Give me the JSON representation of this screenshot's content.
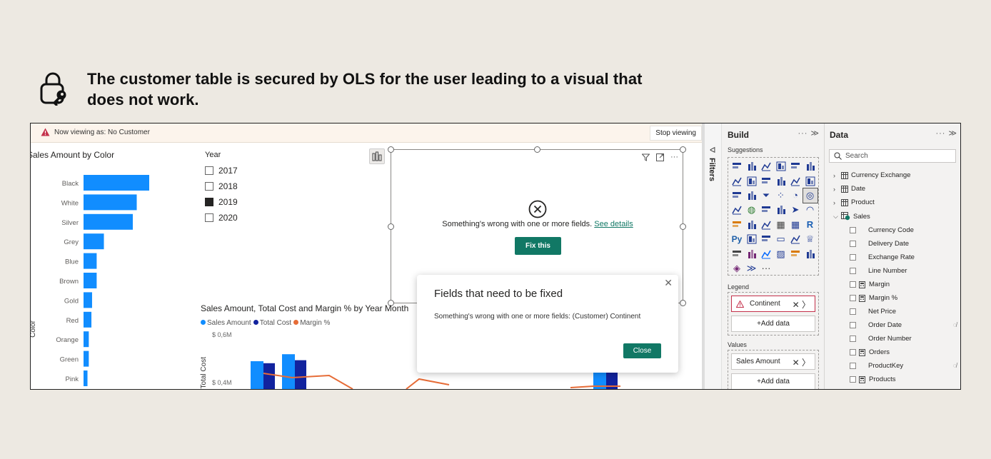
{
  "caption": {
    "text": "The customer table is secured by OLS for the user leading to a visual that does not work.",
    "icon": "lock-key-icon"
  },
  "banner": {
    "text": "Now viewing as: No Customer",
    "stop_label": "Stop viewing"
  },
  "bar_chart": {
    "title": "Sales Amount by Color",
    "axis_label": "Color"
  },
  "chart_data": [
    {
      "type": "bar",
      "orientation": "horizontal",
      "title": "Sales Amount by Color",
      "ylabel": "Color",
      "categories": [
        "Black",
        "White",
        "Silver",
        "Grey",
        "Blue",
        "Brown",
        "Gold",
        "Red",
        "Orange",
        "Green",
        "Pink"
      ],
      "values": [
        100,
        81,
        75,
        31,
        20,
        20,
        13,
        12,
        8,
        8,
        6
      ],
      "color": "#118dff",
      "grid": false
    },
    {
      "type": "bar",
      "title": "Sales Amount, Total Cost and Margin % by Year Month",
      "ylabel": "Total Cost",
      "series": [
        {
          "name": "Sales Amount",
          "color": "#118dff",
          "values": [
            0.35,
            0.42,
            0.38
          ]
        },
        {
          "name": "Total Cost",
          "color": "#12239e",
          "values": [
            0.33,
            0.36,
            0.36
          ]
        },
        {
          "name": "Margin %",
          "color": "#e66c37",
          "type": "line"
        }
      ],
      "yticks": [
        "$ 0,6M",
        "$ 0,4M"
      ]
    }
  ],
  "slicer": {
    "title": "Year",
    "items": [
      {
        "label": "2017",
        "checked": false
      },
      {
        "label": "2018",
        "checked": false
      },
      {
        "label": "2019",
        "checked": true
      },
      {
        "label": "2020",
        "checked": false
      }
    ]
  },
  "error_visual": {
    "message": "Something's wrong with one or more fields.",
    "link": "See details",
    "fix_label": "Fix this"
  },
  "combo_chart": {
    "title": "Sales Amount, Total Cost and Margin % by Year Month",
    "legend": [
      "Sales Amount",
      "Total Cost",
      "Margin %"
    ],
    "ytick_top": "$ 0,6M",
    "ytick_mid": "$ 0,4M",
    "ylabel": "Total Cost"
  },
  "dialog": {
    "title": "Fields that need to be fixed",
    "message": "Something's wrong with one or more fields: (Customer) Continent",
    "close_label": "Close"
  },
  "filters": {
    "label": "Filters"
  },
  "build": {
    "title": "Build",
    "suggestions_label": "Suggestions",
    "legend_label": "Legend",
    "legend_field": "Continent",
    "values_label": "Values",
    "values_field": "Sales Amount",
    "add_data": "+Add data"
  },
  "data_pane": {
    "title": "Data",
    "search_placeholder": "Search",
    "tables": [
      "Currency Exchange",
      "Date",
      "Product",
      "Sales"
    ],
    "fields": [
      {
        "name": "Currency Code",
        "calc": false,
        "hidden": false
      },
      {
        "name": "Delivery Date",
        "calc": false,
        "hidden": false
      },
      {
        "name": "Exchange Rate",
        "calc": false,
        "hidden": false
      },
      {
        "name": "Line Number",
        "calc": false,
        "hidden": false
      },
      {
        "name": "Margin",
        "calc": true,
        "hidden": false
      },
      {
        "name": "Margin %",
        "calc": true,
        "hidden": false
      },
      {
        "name": "Net Price",
        "calc": false,
        "hidden": false
      },
      {
        "name": "Order Date",
        "calc": false,
        "hidden": true
      },
      {
        "name": "Order Number",
        "calc": false,
        "hidden": false
      },
      {
        "name": "Orders",
        "calc": true,
        "hidden": false
      },
      {
        "name": "ProductKey",
        "calc": false,
        "hidden": true
      },
      {
        "name": "Products",
        "calc": true,
        "hidden": false
      }
    ]
  },
  "colors": {
    "accent": "#117865",
    "bar": "#118dff",
    "bar_dark": "#12239e",
    "line": "#e66c37",
    "error": "#c4314b"
  }
}
